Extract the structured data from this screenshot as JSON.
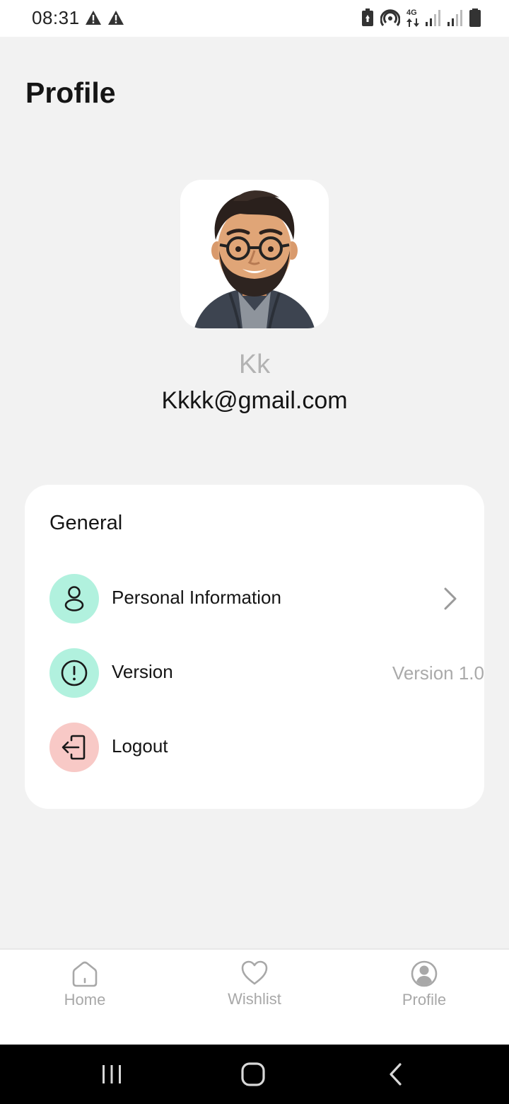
{
  "status_bar": {
    "time": "08:31",
    "network": "4G",
    "left_icons": [
      "warning-icon",
      "warning-icon"
    ],
    "right_icons": [
      "battery-saver-icon",
      "hotspot-icon",
      "4g-data-icon",
      "signal-icon",
      "signal-icon",
      "battery-icon"
    ]
  },
  "page": {
    "title": "Profile"
  },
  "profile": {
    "avatar_icon": "avatar-illustration",
    "name": "Kk",
    "email": "Kkkk@gmail.com"
  },
  "general": {
    "title": "General",
    "items": [
      {
        "label": "Personal Information",
        "icon": "person-icon",
        "icon_bg": "#b1f1de",
        "trailing_icon": "chevron-right-icon"
      },
      {
        "label": "Version",
        "icon": "info-exclamation-icon",
        "icon_bg": "#b1f1de",
        "value": "Version 1.0"
      },
      {
        "label": "Logout",
        "icon": "logout-icon",
        "icon_bg": "#f8c9c6"
      }
    ]
  },
  "bottom_nav": {
    "items": [
      {
        "label": "Home",
        "icon": "home-icon"
      },
      {
        "label": "Wishlist",
        "icon": "heart-icon"
      },
      {
        "label": "Profile",
        "icon": "user-circle-icon"
      }
    ]
  },
  "system_nav": {
    "buttons": [
      "recents-icon",
      "home-circle-icon",
      "back-icon"
    ]
  },
  "colors": {
    "background": "#f2f2f2",
    "card": "#ffffff",
    "mint": "#b1f1de",
    "pink": "#f8c9c6",
    "muted_text": "#aaaaaa"
  }
}
